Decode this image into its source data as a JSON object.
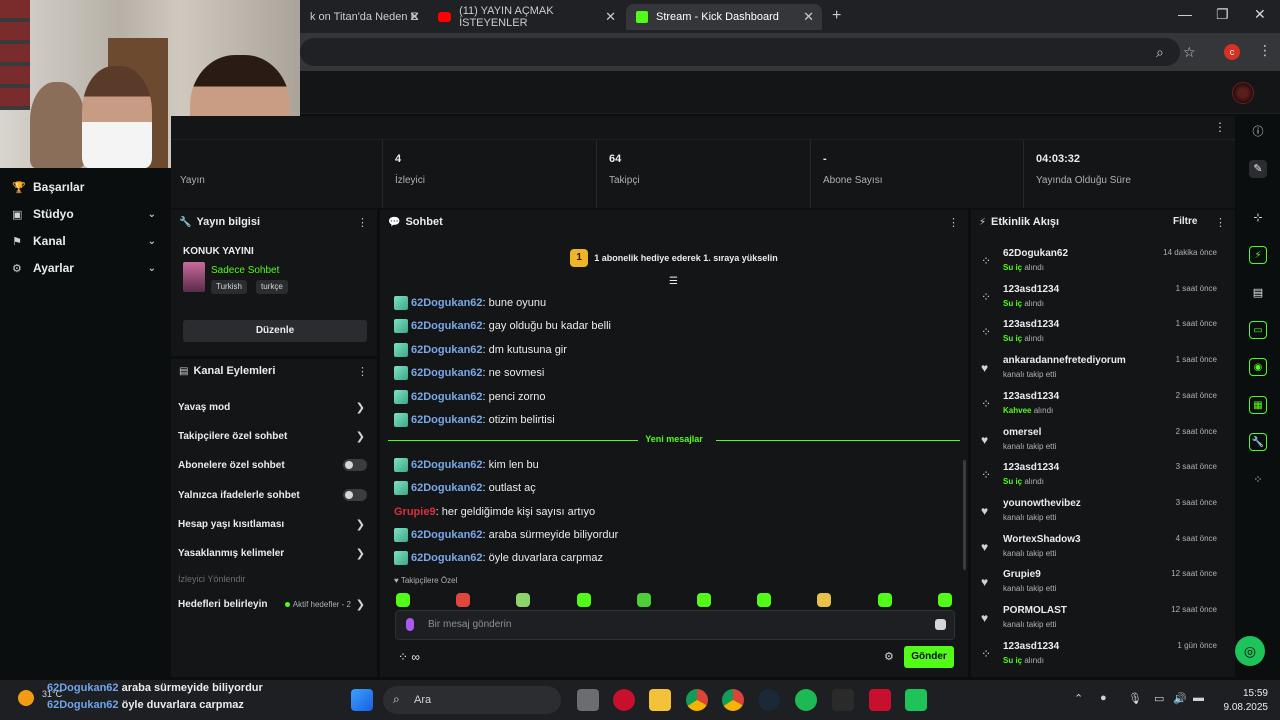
{
  "browser": {
    "tabs": [
      {
        "title": "k on Titan'da Neden E",
        "active": false
      },
      {
        "title": "(11) YAYIN AÇMAK İSTEYENLER",
        "active": false
      },
      {
        "title": "Stream - Kick Dashboard",
        "active": true
      }
    ],
    "new_tab": "+",
    "close": "✕"
  },
  "sidebar": {
    "items": [
      {
        "label": "Başarılar",
        "icon": "trophy-icon",
        "expandable": false
      },
      {
        "label": "Stüdyo",
        "icon": "studio-icon",
        "expandable": true
      },
      {
        "label": "Kanal",
        "icon": "channel-icon",
        "expandable": true
      },
      {
        "label": "Ayarlar",
        "icon": "gear-icon",
        "expandable": true
      }
    ]
  },
  "stats": [
    {
      "value": "",
      "label": "Yayın"
    },
    {
      "value": "4",
      "label": "İzleyici"
    },
    {
      "value": "64",
      "label": "Takipçi"
    },
    {
      "value": "-",
      "label": "Abone Sayısı"
    },
    {
      "value": "04:03:32",
      "label": "Yayında Olduğu Süre"
    }
  ],
  "stream_info": {
    "title": "Yayın bilgisi",
    "stream_title": "KONUK YAYINI",
    "category": "Sadece Sohbet",
    "tags": [
      "Turkish",
      "turkçe"
    ],
    "edit_label": "Düzenle"
  },
  "channel_actions": {
    "title": "Kanal Eylemleri",
    "items": [
      {
        "label": "Yavaş mod",
        "control": "arrow"
      },
      {
        "label": "Takipçilere özel sohbet",
        "control": "arrow"
      },
      {
        "label": "Abonelere özel sohbet",
        "control": "toggle"
      },
      {
        "label": "Yalnızca ifadelerle sohbet",
        "control": "toggle"
      },
      {
        "label": "Hesap yaşı kısıtlaması",
        "control": "arrow"
      },
      {
        "label": "Yasaklanmış kelimeler",
        "control": "arrow"
      }
    ],
    "section_muted": "İzleyici Yönlendir",
    "goals": {
      "label": "Hedefleri belirleyin",
      "extra": "Aktif hedefler - 2"
    }
  },
  "chat": {
    "title": "Sohbet",
    "promo_rank": "1",
    "promo_text": "1 abonelik hediye ederek 1. sıraya yükselin",
    "messages_before": [
      {
        "user": "62Dogukan62",
        "text": "bune oyunu"
      },
      {
        "user": "62Dogukan62",
        "text": "gay olduğu bu kadar belli"
      },
      {
        "user": "62Dogukan62",
        "text": "dm kutusuna gir"
      },
      {
        "user": "62Dogukan62",
        "text": "ne sovmesi"
      },
      {
        "user": "62Dogukan62",
        "text": "penci zorno"
      },
      {
        "user": "62Dogukan62",
        "text": "otizim belirtisi"
      }
    ],
    "new_messages_label": "Yeni mesajlar",
    "messages_after": [
      {
        "user": "62Dogukan62",
        "text": "kim len bu",
        "badge": true
      },
      {
        "user": "62Dogukan62",
        "text": "outlast aç",
        "badge": true
      },
      {
        "user": "Grupie9",
        "text": "her geldiğimde kişi sayısı artıyo",
        "badge": false
      },
      {
        "user": "62Dogukan62",
        "text": "araba sürmeyide biliyordur",
        "badge": true
      },
      {
        "user": "62Dogukan62",
        "text": "öyle duvarlara carpmaz",
        "badge": true
      }
    ],
    "followers_only_note": "♥ Takipçilere Özel",
    "emote_colors": [
      "#53fc18",
      "#e0463a",
      "#8fd46a",
      "#53fc18",
      "#4ecf3a",
      "#53fc18",
      "#53fc18",
      "#e6c24a",
      "#53fc18",
      "#53fc18"
    ],
    "input_placeholder": "Bir mesaj gönderin",
    "footer_symbol": "∞",
    "send_label": "Gönder"
  },
  "activity": {
    "title": "Etkinlik Akışı",
    "filter_label": "Filtre",
    "items": [
      {
        "kind": "reward",
        "name": "62Dogukan62",
        "highlight": "Su iç",
        "sub": " alındı",
        "time": "14 dakika önce"
      },
      {
        "kind": "reward",
        "name": "123asd1234",
        "highlight": "Su iç",
        "sub": " alındı",
        "time": "1 saat önce"
      },
      {
        "kind": "reward",
        "name": "123asd1234",
        "highlight": "Su iç",
        "sub": " alındı",
        "time": "1 saat önce"
      },
      {
        "kind": "follow",
        "name": "ankaradannefretediyorum",
        "highlight": "",
        "sub": "kanalı takip etti",
        "time": "1 saat önce"
      },
      {
        "kind": "reward",
        "name": "123asd1234",
        "highlight": "Kahvee",
        "sub": " alındı",
        "time": "2 saat önce"
      },
      {
        "kind": "follow",
        "name": "omersel",
        "highlight": "",
        "sub": "kanalı takip etti",
        "time": "2 saat önce"
      },
      {
        "kind": "reward",
        "name": "123asd1234",
        "highlight": "Su iç",
        "sub": " alındı",
        "time": "3 saat önce"
      },
      {
        "kind": "follow",
        "name": "younowthevibez",
        "highlight": "",
        "sub": "kanalı takip etti",
        "time": "3 saat önce"
      },
      {
        "kind": "follow",
        "name": "WortexShadow3",
        "highlight": "",
        "sub": "kanalı takip etti",
        "time": "4 saat önce"
      },
      {
        "kind": "follow",
        "name": "Grupie9",
        "highlight": "",
        "sub": "kanalı takip etti",
        "time": "12 saat önce"
      },
      {
        "kind": "follow",
        "name": "PORMOLAST",
        "highlight": "",
        "sub": "kanalı takip etti",
        "time": "12 saat önce"
      },
      {
        "kind": "reward",
        "name": "123asd1234",
        "highlight": "Su iç",
        "sub": " alındı",
        "time": "1 gün önce"
      }
    ]
  },
  "taskbar": {
    "weather_temp": "31°C",
    "search_label": "Ara",
    "overlay_lines": [
      {
        "user": "62Dogukan62",
        "text": "araba sürmeyide biliyordur"
      },
      {
        "user": "62Dogukan62",
        "text": "öyle duvarlara carpmaz"
      }
    ],
    "time": "15:59",
    "date": "9.08.2025"
  }
}
